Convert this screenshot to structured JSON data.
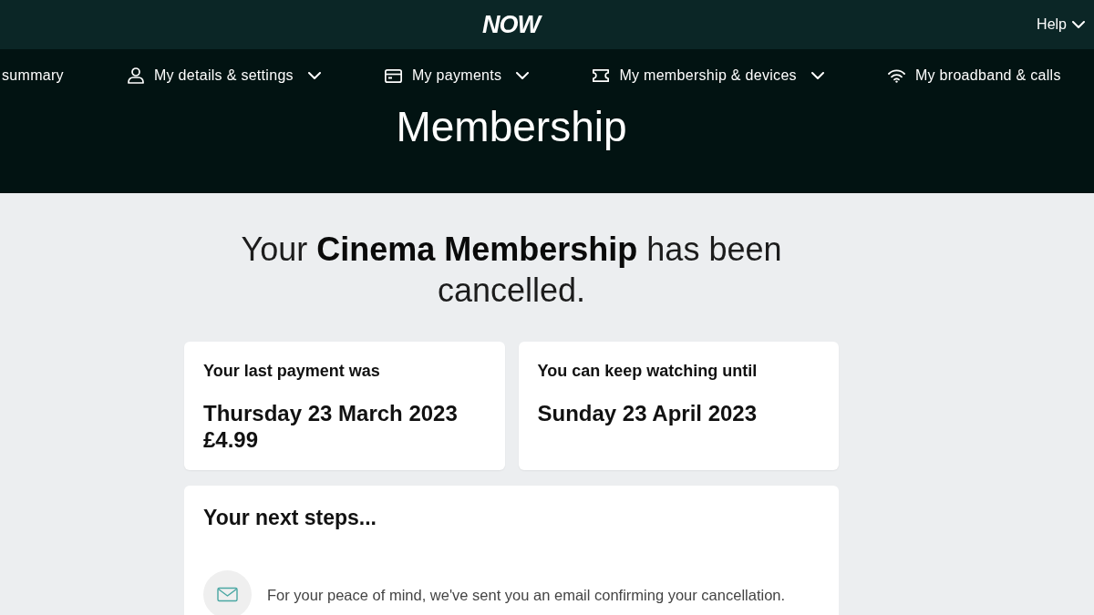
{
  "header": {
    "logo": "NOW",
    "help": "Help"
  },
  "nav": [
    {
      "label": "summary",
      "dropdown": false
    },
    {
      "label": "My details & settings",
      "dropdown": true
    },
    {
      "label": "My payments",
      "dropdown": true
    },
    {
      "label": "My membership & devices",
      "dropdown": true
    },
    {
      "label": "My broadband & calls",
      "dropdown": false
    }
  ],
  "page_title": "Membership",
  "headline": "Your **Cinema Membership** has been cancelled.",
  "cards": [
    {
      "label": "Your last payment was",
      "lines": [
        "Thursday 23 March 2023",
        "£4.99"
      ]
    },
    {
      "label": "You can keep watching until",
      "lines": [
        "Sunday 23 April 2023"
      ]
    }
  ],
  "next_steps": {
    "title": "Your next steps...",
    "items": [
      {
        "text": "For your peace of mind, we've sent you an email confirming your cancellation."
      }
    ]
  }
}
